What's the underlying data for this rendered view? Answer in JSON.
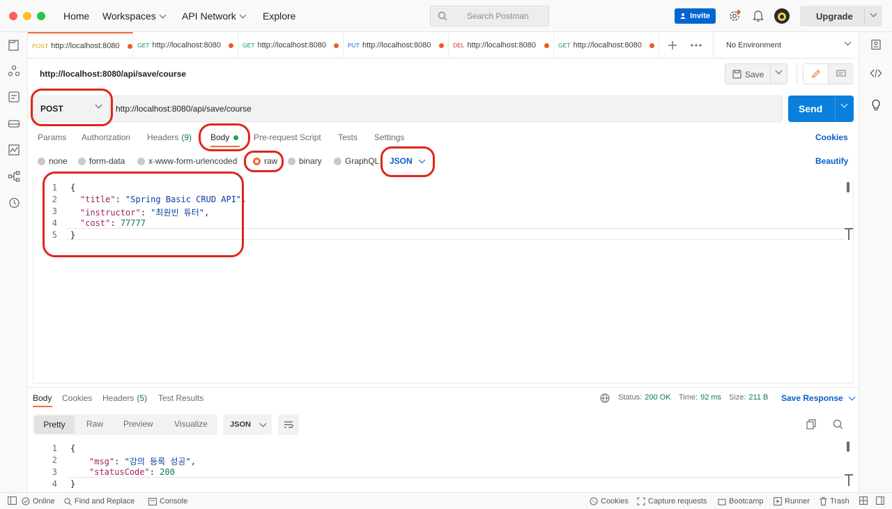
{
  "topnav": {
    "home": "Home",
    "workspaces": "Workspaces",
    "api_network": "API Network",
    "explore": "Explore",
    "search_placeholder": "Search Postman",
    "invite": "Invite",
    "upgrade": "Upgrade"
  },
  "tabs": [
    {
      "method": "POST",
      "url": "http://localhost:8080",
      "color": "#e0a100"
    },
    {
      "method": "GET",
      "url": "http://localhost:8080",
      "color": "#0e8a5f"
    },
    {
      "method": "GET",
      "url": "http://localhost:8080",
      "color": "#0e8a5f"
    },
    {
      "method": "PUT",
      "url": "http://localhost:8080",
      "color": "#0b6fd6"
    },
    {
      "method": "DEL",
      "url": "http://localhost:8080",
      "color": "#d0312d"
    },
    {
      "method": "GET",
      "url": "http://localhost:8080",
      "color": "#0e8a5f"
    }
  ],
  "environment": "No Environment",
  "request": {
    "name": "http://localhost:8080/api/save/course",
    "save": "Save",
    "method": "POST",
    "url": "http://localhost:8080/api/save/course",
    "send": "Send"
  },
  "subtabs": {
    "params": "Params",
    "authorization": "Authorization",
    "headers": "Headers",
    "headers_count": "(9)",
    "body": "Body",
    "prerequest": "Pre-request Script",
    "tests": "Tests",
    "settings": "Settings",
    "cookies": "Cookies"
  },
  "body_types": {
    "none": "none",
    "form_data": "form-data",
    "urlencoded": "x-www-form-urlencoded",
    "raw": "raw",
    "binary": "binary",
    "graphql": "GraphQL",
    "format": "JSON",
    "beautify": "Beautify"
  },
  "request_body": {
    "line_numbers": [
      "1",
      "2",
      "3",
      "4",
      "5"
    ],
    "open": "{",
    "title_key": "\"title\"",
    "title_val": "\"Spring Basic CRUD API\"",
    "instructor_key": "\"instructor\"",
    "instructor_val": "\"최원빈 튜터\"",
    "cost_key": "\"cost\"",
    "cost_val": "77777",
    "close": "}"
  },
  "response": {
    "tabs": {
      "body": "Body",
      "cookies": "Cookies",
      "headers": "Headers",
      "headers_count": "(5)",
      "test_results": "Test Results"
    },
    "status_label": "Status:",
    "status": "200 OK",
    "time_label": "Time:",
    "time": "92 ms",
    "size_label": "Size:",
    "size": "211 B",
    "save_response": "Save Response",
    "views": {
      "pretty": "Pretty",
      "raw": "Raw",
      "preview": "Preview",
      "visualize": "Visualize",
      "format": "JSON"
    },
    "line_numbers": [
      "1",
      "2",
      "3",
      "4"
    ],
    "open": "{",
    "msg_key": "\"msg\"",
    "msg_val": "\"강의 등록 성공\"",
    "status_key": "\"statusCode\"",
    "status_val": "200",
    "close": "}"
  },
  "statusbar": {
    "online": "Online",
    "find_replace": "Find and Replace",
    "console": "Console",
    "cookies": "Cookies",
    "capture": "Capture requests",
    "bootcamp": "Bootcamp",
    "runner": "Runner",
    "trash": "Trash"
  },
  "colors": {
    "accent": "#0a7fdb",
    "annotation": "#e0251b",
    "success": "#0e7a52",
    "tab_dot": "#f05b2a"
  }
}
